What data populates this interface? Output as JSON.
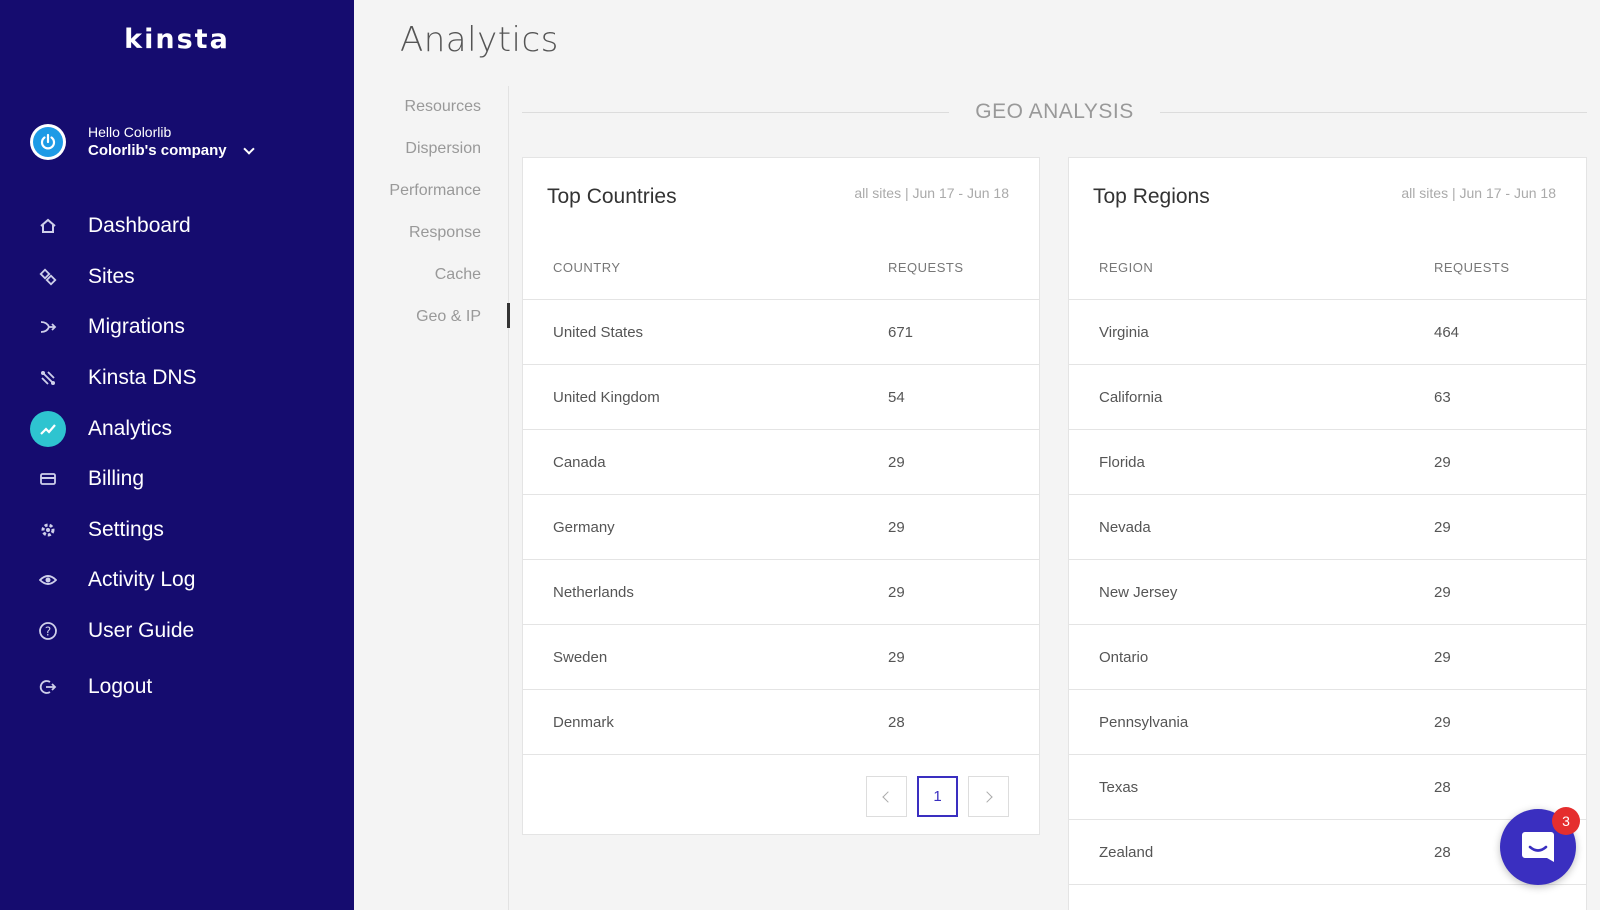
{
  "brand": {
    "logo": "Kinsta"
  },
  "user": {
    "greeting": "Hello Colorlib",
    "company": "Colorlib's company"
  },
  "nav": {
    "items": [
      {
        "label": "Dashboard",
        "icon": "home-icon"
      },
      {
        "label": "Sites",
        "icon": "sites-icon"
      },
      {
        "label": "Migrations",
        "icon": "migrations-icon"
      },
      {
        "label": "Kinsta DNS",
        "icon": "dns-icon"
      },
      {
        "label": "Analytics",
        "icon": "analytics-icon",
        "active": true
      },
      {
        "label": "Billing",
        "icon": "billing-icon"
      },
      {
        "label": "Settings",
        "icon": "gear-icon"
      },
      {
        "label": "Activity Log",
        "icon": "eye-icon"
      },
      {
        "label": "User Guide",
        "icon": "help-icon"
      }
    ],
    "logout": "Logout"
  },
  "page": {
    "title": "Analytics"
  },
  "subnav": {
    "items": [
      "Resources",
      "Dispersion",
      "Performance",
      "Response",
      "Cache",
      "Geo & IP"
    ],
    "active": "Geo & IP"
  },
  "section": {
    "title": "GEO ANALYSIS"
  },
  "countries": {
    "title": "Top Countries",
    "range": "all sites | Jun 17 - Jun 18",
    "col1": "COUNTRY",
    "col2": "REQUESTS",
    "rows": [
      {
        "name": "United States",
        "requests": "671"
      },
      {
        "name": "United Kingdom",
        "requests": "54"
      },
      {
        "name": "Canada",
        "requests": "29"
      },
      {
        "name": "Germany",
        "requests": "29"
      },
      {
        "name": "Netherlands",
        "requests": "29"
      },
      {
        "name": "Sweden",
        "requests": "29"
      },
      {
        "name": "Denmark",
        "requests": "28"
      }
    ],
    "page": "1"
  },
  "regions": {
    "title": "Top Regions",
    "range": "all sites | Jun 17 - Jun 18",
    "col1": "REGION",
    "col2": "REQUESTS",
    "rows": [
      {
        "name": "Virginia",
        "requests": "464"
      },
      {
        "name": "California",
        "requests": "63"
      },
      {
        "name": "Florida",
        "requests": "29"
      },
      {
        "name": "Nevada",
        "requests": "29"
      },
      {
        "name": "New Jersey",
        "requests": "29"
      },
      {
        "name": "Ontario",
        "requests": "29"
      },
      {
        "name": "Pennsylvania",
        "requests": "29"
      },
      {
        "name": "Texas",
        "requests": "28"
      },
      {
        "name": "Zealand",
        "requests": "28"
      }
    ]
  },
  "chat": {
    "badge": "3",
    "icon": "chat-icon"
  },
  "colors": {
    "sidebar": "#150c6f",
    "accent": "#2ec4d0",
    "primary": "#3a2fc0",
    "badge": "#e52e2e"
  }
}
